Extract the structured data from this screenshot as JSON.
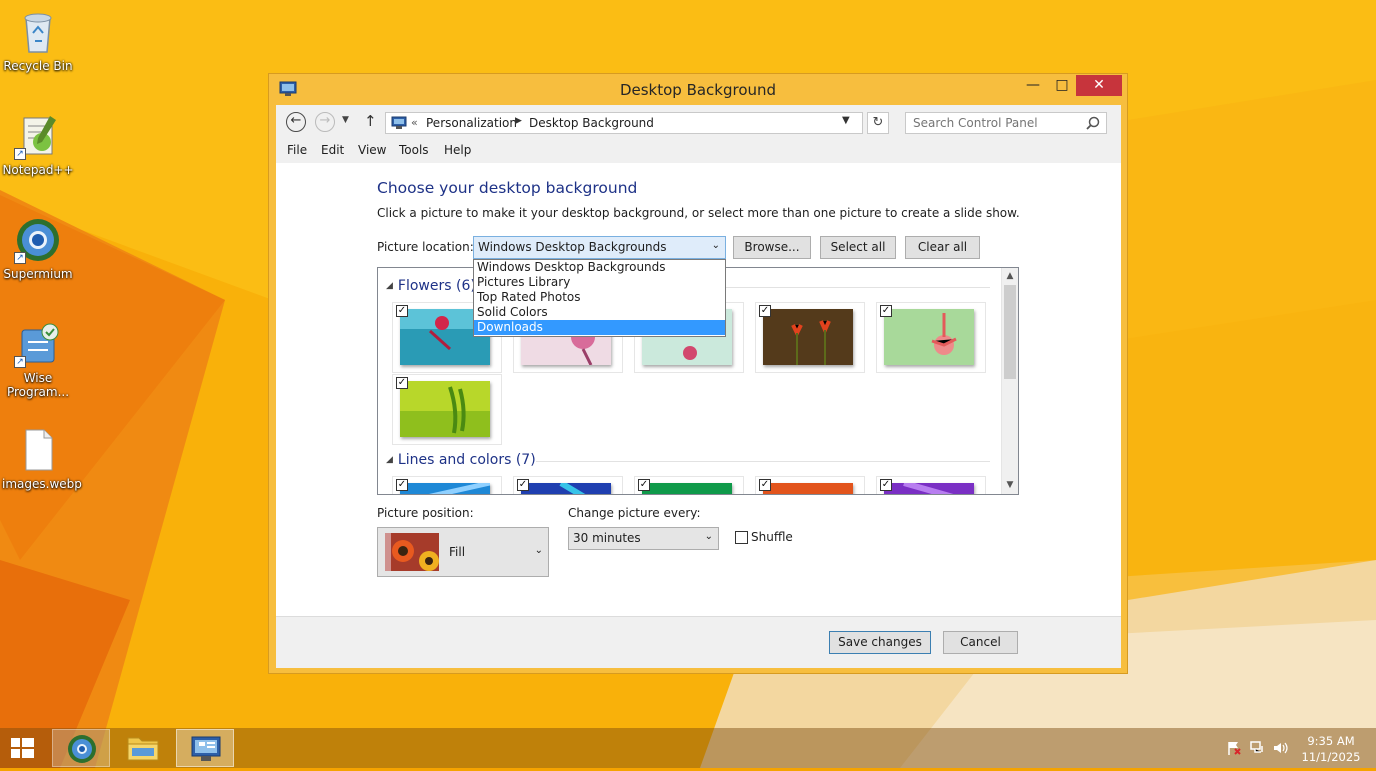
{
  "desktop": {
    "icons": [
      {
        "label": "Recycle Bin"
      },
      {
        "label": "Notepad++"
      },
      {
        "label": "Supermium"
      },
      {
        "label": "Wise Program..."
      },
      {
        "label": "images.webp"
      }
    ]
  },
  "window": {
    "title": "Desktop Background",
    "controls": {
      "minimize": "—",
      "maximize": "□",
      "close": "✕"
    }
  },
  "address_bar": {
    "separator": "«",
    "crumbs": [
      "Personalization",
      "Desktop Background"
    ],
    "search_placeholder": "Search Control Panel"
  },
  "menu": [
    "File",
    "Edit",
    "View",
    "Tools",
    "Help"
  ],
  "content": {
    "heading": "Choose your desktop background",
    "subtitle": "Click a picture to make it your desktop background, or select more than one picture to create a slide show.",
    "location_label": "Picture location:",
    "location_value": "Windows Desktop Backgrounds",
    "location_options": [
      "Windows Desktop Backgrounds",
      "Pictures Library",
      "Top Rated Photos",
      "Solid Colors",
      "Downloads"
    ],
    "location_highlighted": "Downloads",
    "buttons": {
      "browse": "Browse...",
      "select_all": "Select all",
      "clear_all": "Clear all"
    }
  },
  "gallery": {
    "groups": [
      {
        "title": "Flowers (6)",
        "items": 6
      },
      {
        "title": "Lines and colors (7)",
        "items": 7
      }
    ]
  },
  "options": {
    "position_label": "Picture position:",
    "position_value": "Fill",
    "interval_label": "Change picture every:",
    "interval_value": "30 minutes",
    "shuffle_label": "Shuffle",
    "shuffle_checked": false
  },
  "footer": {
    "save": "Save changes",
    "cancel": "Cancel"
  },
  "taskbar": {
    "time": "9:35 AM",
    "date": "11/1/2025"
  },
  "colors": {
    "accent": "#f7be3e",
    "close": "#c7343c",
    "link": "#1e3287",
    "highlight": "#3399ff"
  }
}
